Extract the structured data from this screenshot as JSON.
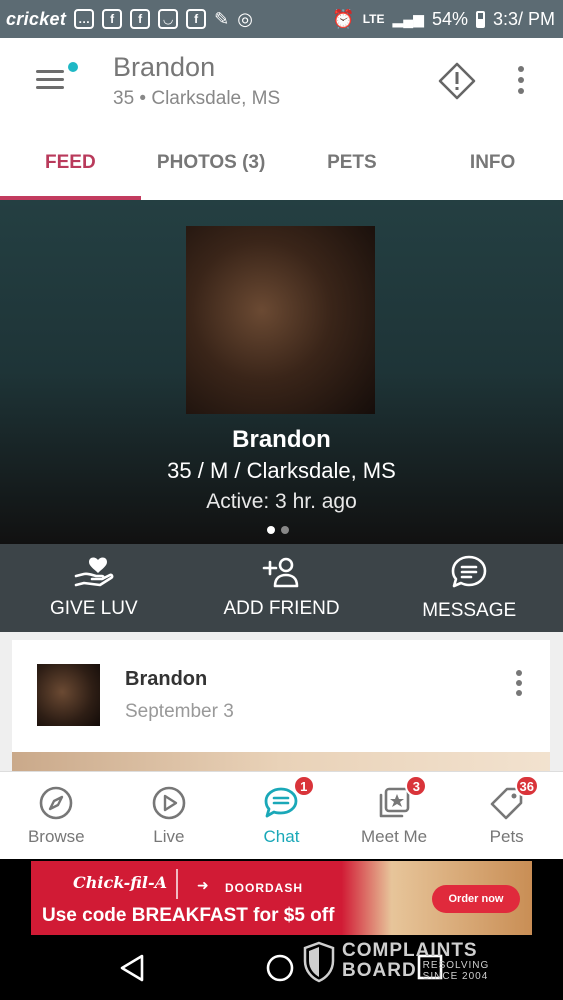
{
  "status_bar": {
    "carrier": "cricket",
    "network": "LTE",
    "battery": "54%",
    "time": "3:3/ PM"
  },
  "app_bar": {
    "title": "Brandon",
    "subtitle": "35 • Clarksdale, MS"
  },
  "tabs": [
    {
      "label": "FEED",
      "active": true
    },
    {
      "label": "PHOTOS (3)",
      "active": false
    },
    {
      "label": "PETS",
      "active": false
    },
    {
      "label": "INFO",
      "active": false
    }
  ],
  "profile": {
    "name": "Brandon",
    "details": "35 / M / Clarksdale, MS",
    "active": "Active: 3 hr. ago",
    "carousel_count": 2,
    "carousel_index": 0
  },
  "actions": [
    {
      "label": "GIVE LUV",
      "icon": "heart-hand-icon"
    },
    {
      "label": "ADD FRIEND",
      "icon": "add-friend-icon"
    },
    {
      "label": "MESSAGE",
      "icon": "message-icon"
    }
  ],
  "post": {
    "author": "Brandon",
    "date": "September 3"
  },
  "bottom_nav": [
    {
      "label": "Browse",
      "icon": "compass-icon",
      "badge": ""
    },
    {
      "label": "Live",
      "icon": "play-icon",
      "badge": ""
    },
    {
      "label": "Chat",
      "icon": "chat-icon",
      "badge": "1",
      "active": true
    },
    {
      "label": "Meet Me",
      "icon": "meet-me-icon",
      "badge": "3"
    },
    {
      "label": "Pets",
      "icon": "tag-icon",
      "badge": "36"
    }
  ],
  "ad": {
    "brand": "Chick-fil-A",
    "partner": "DOORDASH",
    "text": "Use code BREAKFAST for $5 off",
    "cta": "Order now"
  },
  "watermark": {
    "line1": "COMPLAINTS",
    "line2": "BOARD",
    "tag1": "RESOLVING",
    "tag2": "SINCE 2004"
  },
  "colors": {
    "accent": "#c23b5f",
    "chat_active": "#1aa8b8",
    "badge": "#d9343a",
    "status_bar": "#5c6b73",
    "action_bar": "#3c4448"
  }
}
